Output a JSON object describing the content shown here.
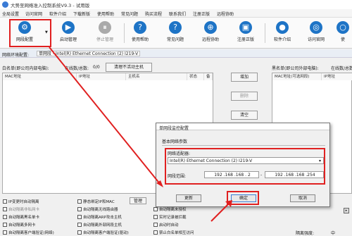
{
  "window": {
    "title": "大势至网络准入控制系统V9.3 - 试用版"
  },
  "menu": [
    "全局设置",
    "访问官网",
    "软件介绍",
    "下载新版",
    "使用帮助",
    "常见问题",
    "购买流程",
    "联系我们",
    "注册正版",
    "远程协助"
  ],
  "toolbar": [
    {
      "label": "网段配置",
      "icon": "gear-icon",
      "glyph": "⚙"
    },
    {
      "label": "启动管理",
      "icon": "play-icon",
      "glyph": "▶"
    },
    {
      "label": "停止管理",
      "icon": "pause-icon",
      "glyph": "⏸"
    },
    {
      "label": "使用帮助",
      "icon": "help-icon",
      "glyph": "?"
    },
    {
      "label": "常见问题",
      "icon": "question-icon",
      "glyph": "?"
    },
    {
      "label": "远程协助",
      "icon": "remote-icon",
      "glyph": "⊕"
    },
    {
      "label": "注册正版",
      "icon": "register-icon",
      "glyph": "▣"
    },
    {
      "label": "软件介绍",
      "icon": "info-icon",
      "glyph": "●"
    },
    {
      "label": "访问官网",
      "icon": "web-icon",
      "glyph": "◎"
    },
    {
      "label": "使",
      "icon": "more-icon",
      "glyph": "○"
    }
  ],
  "netenv": {
    "label": "网络环境配置:",
    "value": "单网段 - Intel(R) Ethernet Connection (2) I219-V"
  },
  "whitelist": {
    "title": "白名单(即公司内部电脑):",
    "online_label": "在线数/总数:",
    "online_value": "0/0",
    "clear_button": "清理不活动主机",
    "columns": [
      "MAC地址",
      "IP地址",
      "主机名",
      "状态",
      "备"
    ]
  },
  "side_buttons": [
    "增加",
    "删除",
    "清空"
  ],
  "blacklist": {
    "title": "黑名单(即公司外部电脑):",
    "online_label": "在线数/总数:",
    "online_value": "0",
    "columns": [
      "MAC地址(可选网段)",
      "IP地址"
    ]
  },
  "options": {
    "col1": [
      "IP变更时自动隔离",
      "自动隔离非私网卡",
      "自动隔离黑名单卡",
      "自动隔离多网卡"
    ],
    "col2": [
      "静态绑定IP和MAC",
      "自动隔离无线路由器",
      "自动隔离ARP攻击主机",
      "自动隔离外部网段主机"
    ],
    "col3": [
      "自动隔离未授权",
      "实时记录被拦截",
      "启动时自动"
    ],
    "manage_button": "管理",
    "bottom_left": "自动隔离客户端验证(网络)",
    "bottom_mid": "自动隔离客户端验证(驱动)",
    "bottom_right": "禁止白名单相互访问",
    "isolation_label": "隔离强度:",
    "isolation_value": "中"
  },
  "dialog": {
    "title": "单网段监控配置",
    "section": "基本网络参数",
    "adapter_label": "网络适配器:",
    "adapter_value": "Intel(R) Ethernet Connection (2) I219-V",
    "range_label": "网段范围:",
    "range_start": "192 .168 .168 . 2",
    "range_sep": "-",
    "range_end": "192 .168 .168 .254",
    "update_button": "更新",
    "ok_button": "确定",
    "cancel_button": "取消"
  }
}
